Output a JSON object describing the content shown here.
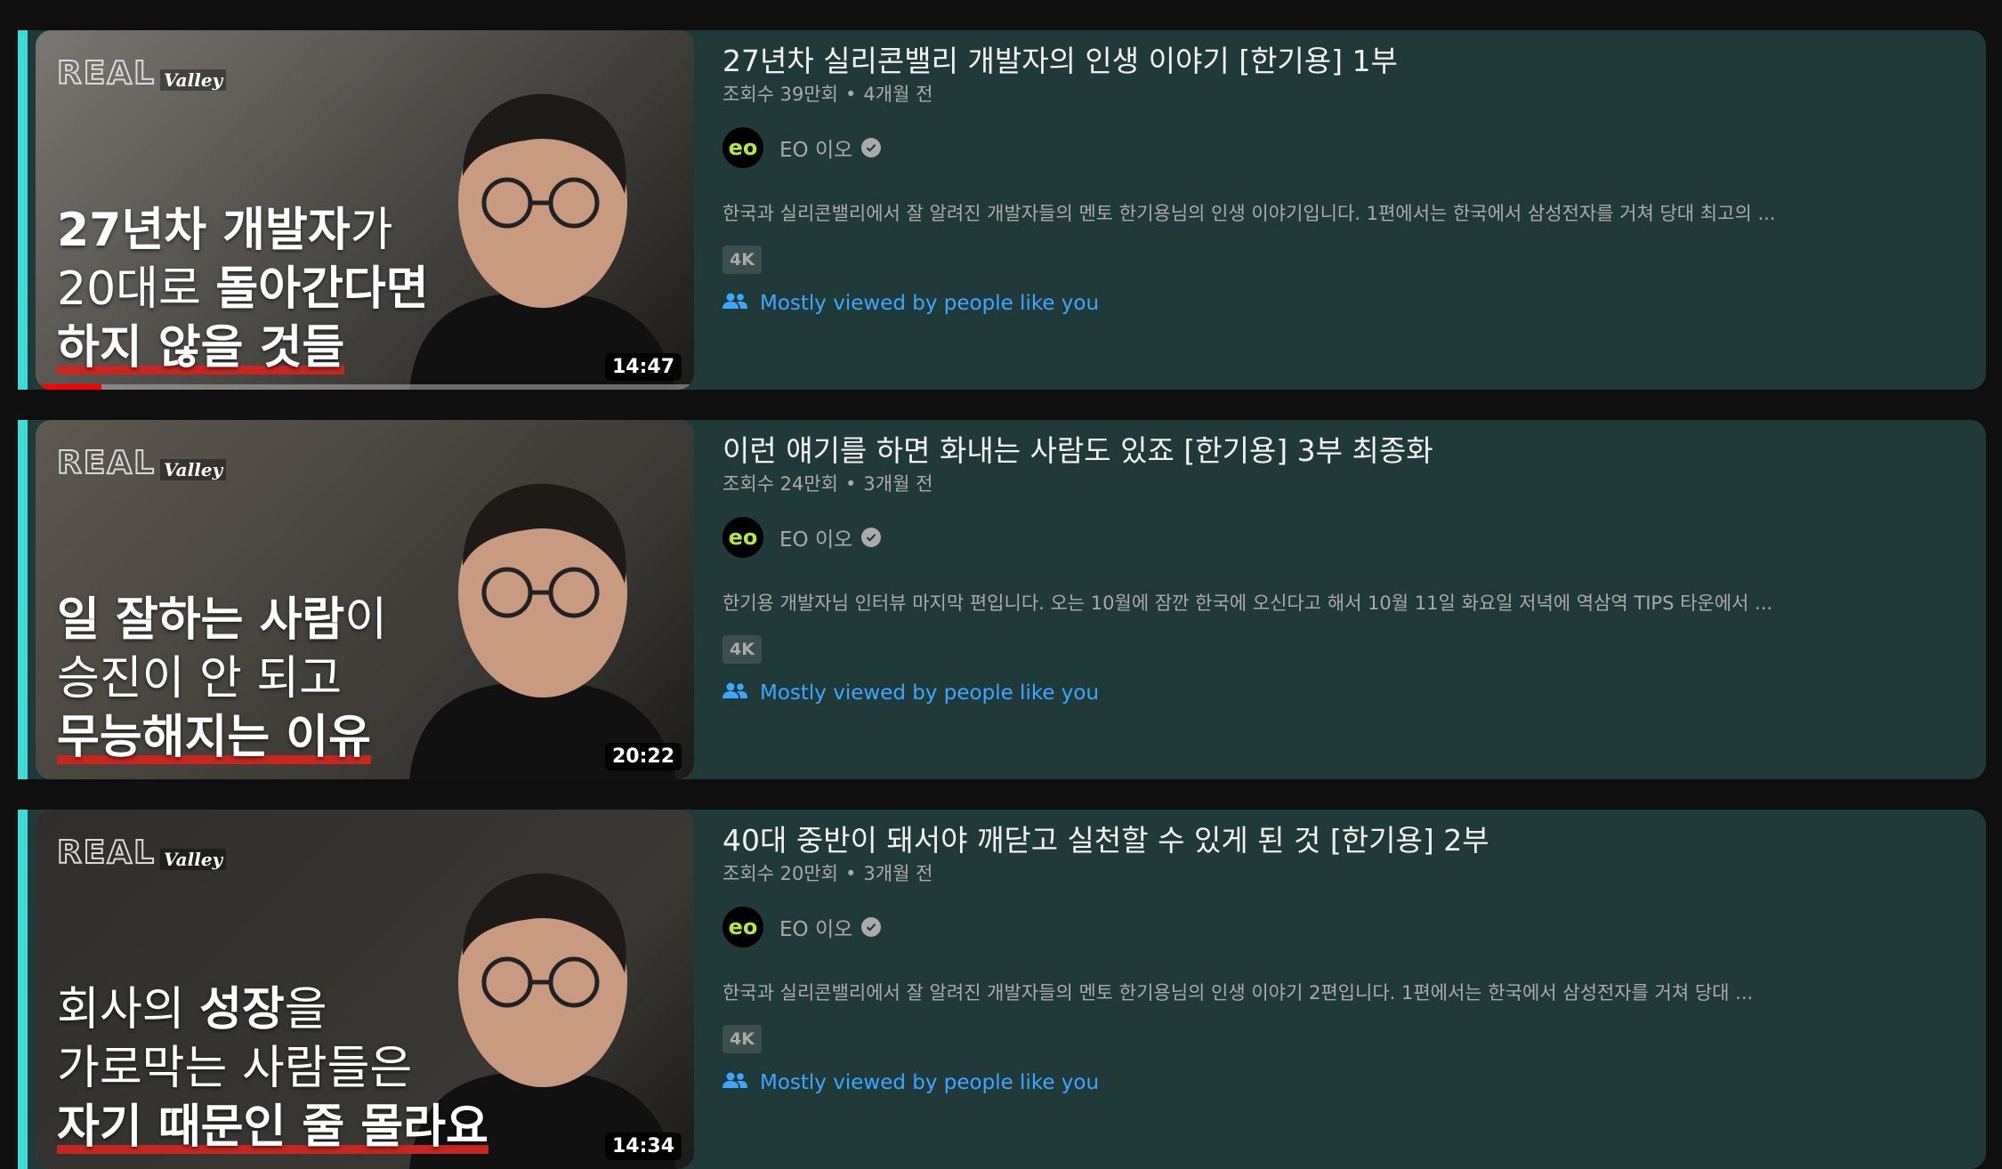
{
  "videos": [
    {
      "title": "27년차 실리콘밸리 개발자의 인생 이야기 [한기용] 1부",
      "views": "조회수 39만회",
      "age": "4개월 전",
      "channel": "EO 이오",
      "channel_avatar_text": "eo",
      "description": "한국과 실리콘밸리에서 잘 알려진 개발자들의 멘토 한기용님의 인생 이야기입니다. 1편에서는 한국에서 삼성전자를 거쳐 당대 최고의 ...",
      "badge": "4K",
      "recommendation": "Mostly viewed by people like you",
      "duration": "14:47",
      "watch_progress": 0.1,
      "thumb_brand": "REAL",
      "thumb_brand_sub": "Valley",
      "thumb_caption": [
        [
          {
            "text": "27년차 개발자",
            "style": "bold"
          },
          {
            "text": "가",
            "style": "thin"
          }
        ],
        [
          {
            "text": "20대로 ",
            "style": "thin"
          },
          {
            "text": "돌아간다면",
            "style": "bold"
          }
        ],
        [
          {
            "text": "하지 않을 것들",
            "style": "bold-underline"
          }
        ]
      ],
      "thumb_bg": "#7a7772"
    },
    {
      "title": "이런 얘기를 하면 화내는 사람도 있죠 [한기용] 3부 최종화",
      "views": "조회수 24만회",
      "age": "3개월 전",
      "channel": "EO 이오",
      "channel_avatar_text": "eo",
      "description": "한기용 개발자님 인터뷰 마지막 편입니다. 오는 10월에 잠깐 한국에 오신다고 해서 10월 11일 화요일 저녁에 역삼역 TIPS 타운에서 ...",
      "badge": "4K",
      "recommendation": "Mostly viewed by people like you",
      "duration": "20:22",
      "watch_progress": 0,
      "thumb_brand": "REAL",
      "thumb_brand_sub": "Valley",
      "thumb_caption": [
        [
          {
            "text": "일 잘하는 사람",
            "style": "bold"
          },
          {
            "text": "이",
            "style": "thin"
          }
        ],
        [
          {
            "text": "승진이 안 되고",
            "style": "thin"
          }
        ],
        [
          {
            "text": "무능해지는 이유",
            "style": "bold-underline"
          }
        ]
      ],
      "thumb_bg": "#5d5850"
    },
    {
      "title": "40대 중반이 돼서야 깨닫고 실천할 수 있게 된 것 [한기용] 2부",
      "views": "조회수 20만회",
      "age": "3개월 전",
      "channel": "EO 이오",
      "channel_avatar_text": "eo",
      "description": "한국과 실리콘밸리에서 잘 알려진 개발자들의 멘토 한기용님의 인생 이야기 2편입니다. 1편에서는 한국에서 삼성전자를 거쳐 당대 ...",
      "badge": "4K",
      "recommendation": "Mostly viewed by people like you",
      "duration": "14:34",
      "watch_progress": 0,
      "thumb_brand": "REAL",
      "thumb_brand_sub": "Valley",
      "thumb_caption": [
        [
          {
            "text": "회사의 ",
            "style": "thin"
          },
          {
            "text": "성장",
            "style": "bold"
          },
          {
            "text": "을",
            "style": "thin"
          }
        ],
        [
          {
            "text": "가로막는 사람들은",
            "style": "thin"
          }
        ],
        [
          {
            "text": "자기 때문인 줄 몰라요",
            "style": "bold-underline"
          }
        ]
      ],
      "thumb_bg": "#2f2e2c"
    }
  ],
  "colors": {
    "row_bg": "#203a3a",
    "accent": "#3ddbd3",
    "link": "#3ea6ff",
    "progress": "#ff0000"
  }
}
